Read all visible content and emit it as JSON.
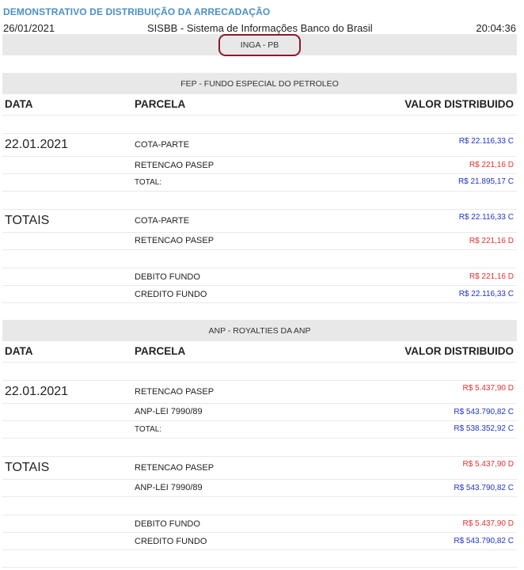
{
  "header": {
    "title": "DEMONSTRATIVO DE DISTRIBUIÇÃO DA ARRECADAÇÃO",
    "date": "26/01/2021",
    "system": "SISBB - Sistema de Informações Banco do Brasil",
    "time": "20:04:36",
    "city": "INGA - PB"
  },
  "columns": {
    "date": "DATA",
    "parcel": "PARCELA",
    "value": "VALOR DISTRIBUIDO"
  },
  "fep": {
    "title": "FEP - FUNDO ESPECIAL DO PETROLEO",
    "date_label": "22.01.2021",
    "rows": [
      {
        "label": "COTA-PARTE",
        "value": "R$ 22.116,33 C"
      },
      {
        "label": "RETENCAO PASEP",
        "value": "R$ 221,16 D"
      },
      {
        "label": "TOTAL:",
        "value": "R$ 21.895,17 C"
      }
    ],
    "totals_label": "TOTAIS",
    "totals": [
      {
        "label": "COTA-PARTE",
        "value": "R$ 22.116,33 C"
      },
      {
        "label": "RETENCAO PASEP",
        "value": "R$ 221,16 D"
      }
    ],
    "fund": [
      {
        "label": "DEBITO FUNDO",
        "value": "R$ 221,16 D"
      },
      {
        "label": "CREDITO FUNDO",
        "value": "R$ 22.116,33 C"
      }
    ]
  },
  "anp": {
    "title": "ANP - ROYALTIES DA ANP",
    "date_label": "22.01.2021",
    "rows": [
      {
        "label": "RETENCAO PASEP",
        "value": "R$ 5.437,90 D"
      },
      {
        "label": "ANP-LEI 7990/89",
        "value": "R$ 543.790,82 C"
      },
      {
        "label": "TOTAL:",
        "value": "R$ 538.352,92 C"
      }
    ],
    "totals_label": "TOTAIS",
    "totals": [
      {
        "label": "RETENCAO PASEP",
        "value": "R$ 5.437,90 D"
      },
      {
        "label": "ANP-LEI 7990/89",
        "value": "R$ 543.790,82 C"
      }
    ],
    "fund": [
      {
        "label": "DEBITO FUNDO",
        "value": "R$ 5.437,90 D"
      },
      {
        "label": "CREDITO FUNDO",
        "value": "R$ 543.790,82 C"
      }
    ]
  }
}
